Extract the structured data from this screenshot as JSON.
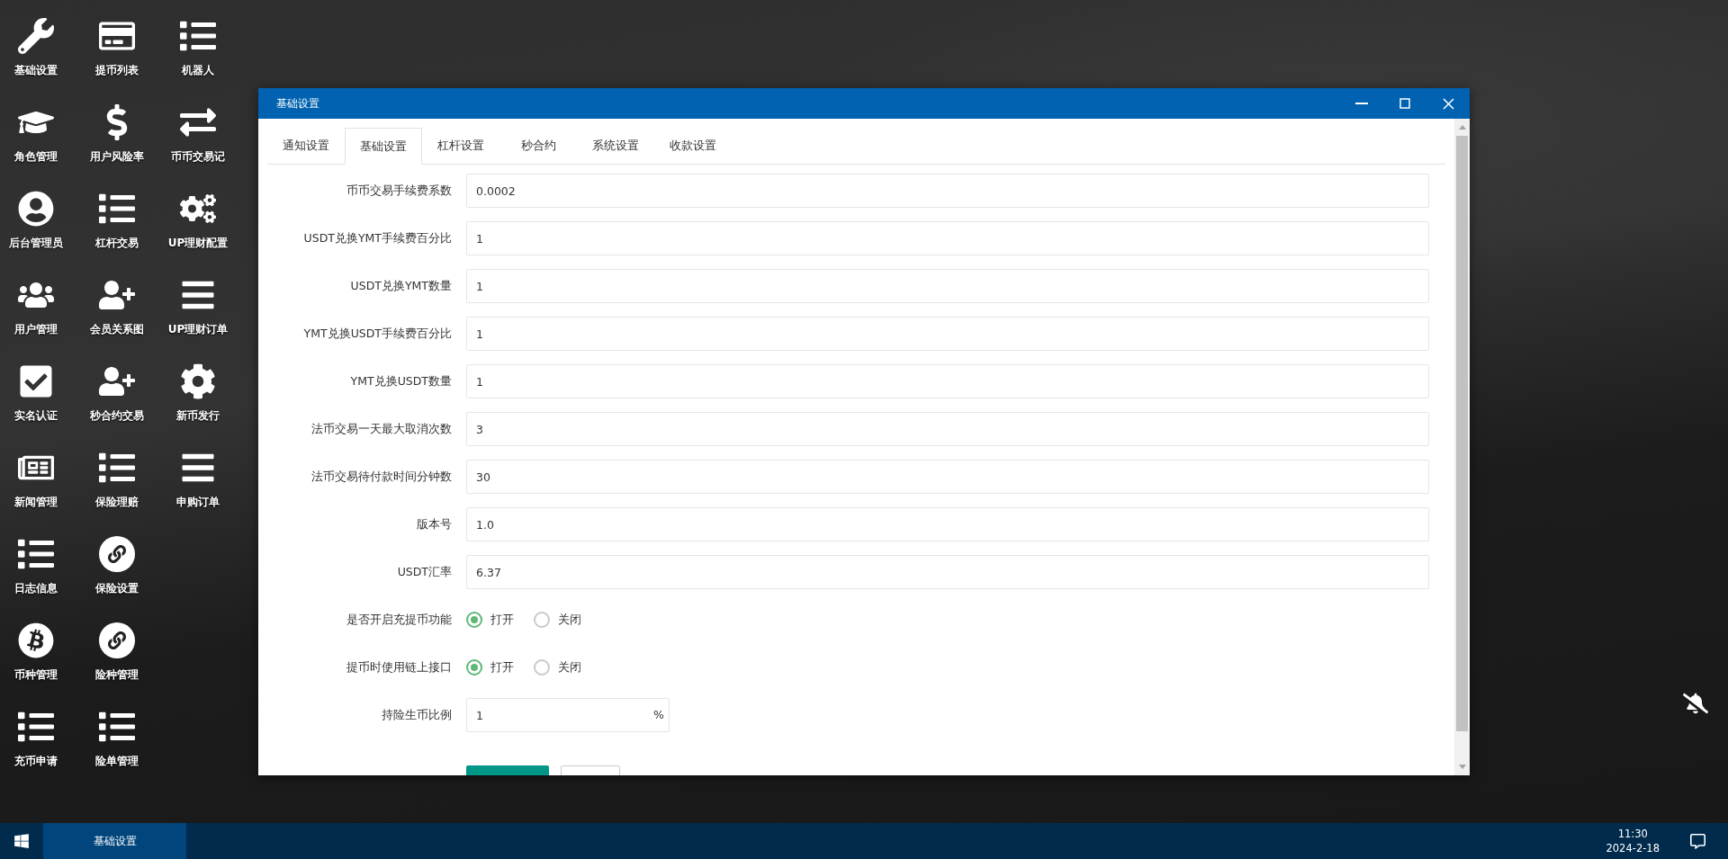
{
  "desktop_icons": [
    {
      "label": "基础设置",
      "kind": "wrench"
    },
    {
      "label": "角色管理",
      "kind": "graduation"
    },
    {
      "label": "后台管理员",
      "kind": "user-circle"
    },
    {
      "label": "用户管理",
      "kind": "users"
    },
    {
      "label": "实名认证",
      "kind": "check"
    },
    {
      "label": "新闻管理",
      "kind": "newspaper"
    },
    {
      "label": "日志信息",
      "kind": "list"
    },
    {
      "label": "币种管理",
      "kind": "bitcoin"
    },
    {
      "label": "充币申请",
      "kind": "list"
    },
    {
      "label": "提币列表",
      "kind": "card"
    },
    {
      "label": "用户风险率",
      "kind": "dollar"
    },
    {
      "label": "杠杆交易",
      "kind": "list"
    },
    {
      "label": "会员关系图",
      "kind": "user-plus"
    },
    {
      "label": "秒合约交易",
      "kind": "user-plus"
    },
    {
      "label": "保险理赔",
      "kind": "list"
    },
    {
      "label": "保险设置",
      "kind": "link-circle"
    },
    {
      "label": "险种管理",
      "kind": "link-circle"
    },
    {
      "label": "险单管理",
      "kind": "list"
    },
    {
      "label": "机器人",
      "kind": "list"
    },
    {
      "label": "币币交易记",
      "kind": "exchange"
    },
    {
      "label": "UP理财配置",
      "kind": "cogs"
    },
    {
      "label": "UP理财订单",
      "kind": "bars"
    },
    {
      "label": "新币发行",
      "kind": "cog"
    },
    {
      "label": "申购订单",
      "kind": "bars"
    }
  ],
  "window": {
    "title": "基础设置",
    "tabs": [
      {
        "label": "通知设置",
        "selected": false
      },
      {
        "label": "基础设置",
        "selected": true
      },
      {
        "label": "杠杆设置",
        "selected": false
      },
      {
        "label": "秒合约",
        "selected": false
      },
      {
        "label": "系统设置",
        "selected": false
      },
      {
        "label": "收款设置",
        "selected": false
      }
    ],
    "fields": [
      {
        "kind": "text",
        "label": "币币交易手续费系数",
        "value": "0.0002"
      },
      {
        "kind": "text",
        "label": "USDT兑换YMT手续费百分比",
        "value": "1"
      },
      {
        "kind": "text",
        "label": "USDT兑换YMT数量",
        "value": "1"
      },
      {
        "kind": "text",
        "label": "YMT兑换USDT手续费百分比",
        "value": "1"
      },
      {
        "kind": "text",
        "label": "YMT兑换USDT数量",
        "value": "1"
      },
      {
        "kind": "text",
        "label": "法币交易一天最大取消次数",
        "value": "3"
      },
      {
        "kind": "text",
        "label": "法币交易待付款时间分钟数",
        "value": "30"
      },
      {
        "kind": "text",
        "label": "版本号",
        "value": "1.0"
      },
      {
        "kind": "text",
        "label": "USDT汇率",
        "value": "6.37"
      },
      {
        "kind": "radio",
        "label": "是否开启充提币功能",
        "options": [
          {
            "label": "打开",
            "selected": true
          },
          {
            "label": "关闭",
            "selected": false
          }
        ]
      },
      {
        "kind": "radio",
        "label": "提币时使用链上接口",
        "options": [
          {
            "label": "打开",
            "selected": true
          },
          {
            "label": "关闭",
            "selected": false
          }
        ]
      },
      {
        "kind": "suffix",
        "label": "持险生币比例",
        "value": "1",
        "suffix": "%"
      }
    ]
  },
  "taskbar": {
    "task": "基础设置",
    "time": "11:30",
    "date": "2024-2-18"
  }
}
